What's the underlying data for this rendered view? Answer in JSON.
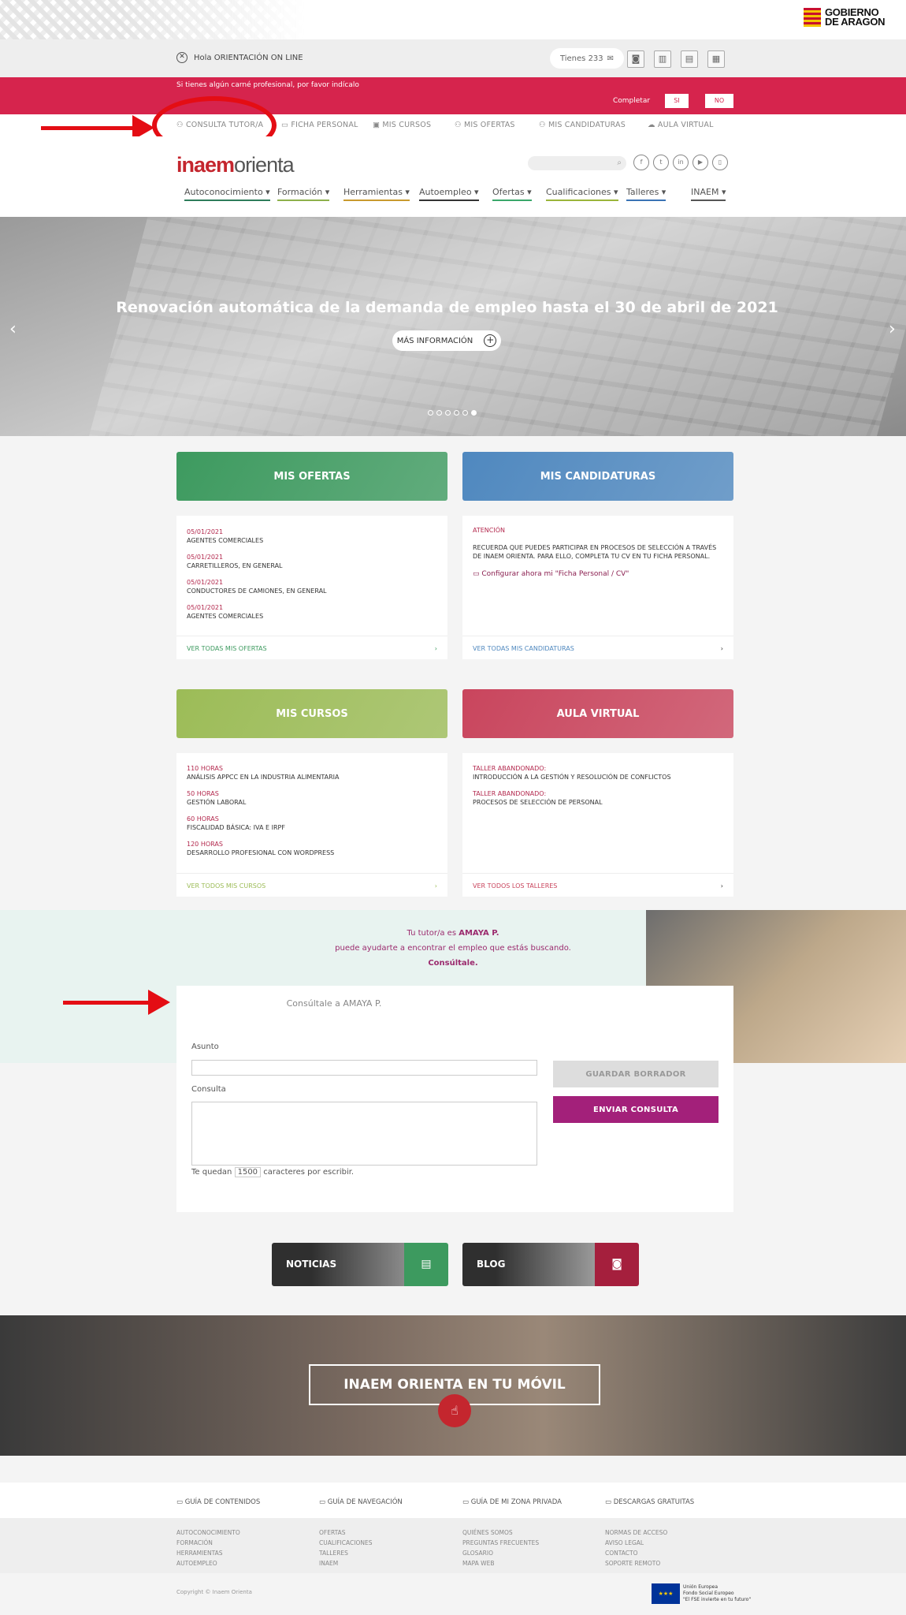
{
  "brand": {
    "gobierno": "GOBIERNO\nDE ARAGON",
    "logo_a": "inaem",
    "logo_b": "orienta"
  },
  "userbar": {
    "greeting": "Hola ORIENTACIÓN ON LINE",
    "tienes": "Tienes 233"
  },
  "alert": {
    "message": "Si tienes algún carné profesional, por favor indícalo",
    "completar": "Completar",
    "si": "SI",
    "no": "NO"
  },
  "secnav": [
    "CONSULTA TUTOR/A",
    "FICHA PERSONAL",
    "MIS CURSOS",
    "MIS OFERTAS",
    "MIS CANDIDATURAS",
    "AULA VIRTUAL"
  ],
  "mainnav": [
    {
      "label": "Autoconocimiento",
      "color": "#2e7d5b"
    },
    {
      "label": "Formación",
      "color": "#8db04b"
    },
    {
      "label": "Herramientas",
      "color": "#c99a2e"
    },
    {
      "label": "Autoempleo",
      "color": "#333333"
    },
    {
      "label": "Ofertas",
      "color": "#3aa86b"
    },
    {
      "label": "Cualificaciones",
      "color": "#9bb53a"
    },
    {
      "label": "Talleres",
      "color": "#3a73b5"
    },
    {
      "label": "INAEM",
      "color": "#555555"
    }
  ],
  "hero": {
    "title": "Renovación automática de la demanda de empleo hasta el 30 de abril de 2021",
    "button": "MÁS INFORMACIÓN",
    "slides": 6,
    "active": 5
  },
  "cards": {
    "ofertas": {
      "title": "MIS OFERTAS",
      "items": [
        {
          "date": "05/01/2021",
          "text": "AGENTES COMERCIALES"
        },
        {
          "date": "05/01/2021",
          "text": "CARRETILLEROS, EN GENERAL"
        },
        {
          "date": "05/01/2021",
          "text": "CONDUCTORES DE CAMIONES, EN GENERAL"
        },
        {
          "date": "05/01/2021",
          "text": "AGENTES COMERCIALES"
        }
      ],
      "footer": "VER TODAS MIS OFERTAS",
      "color": "#3d9a5f"
    },
    "candidaturas": {
      "title": "MIS CANDIDATURAS",
      "atencion": "ATENCIÓN",
      "text": "RECUERDA QUE PUEDES PARTICIPAR EN PROCESOS DE SELECCIÓN A TRAVÉS DE INAEM ORIENTA. PARA ELLO, COMPLETA TU CV EN TU FICHA PERSONAL.",
      "link": "Configurar ahora mi \"Ficha Personal / CV\"",
      "footer": "VER TODAS MIS CANDIDATURAS",
      "color": "#4f88bf"
    },
    "cursos": {
      "title": "MIS CURSOS",
      "items": [
        {
          "date": "110 HORAS",
          "text": "ANÁLISIS APPCC EN LA INDUSTRIA ALIMENTARIA"
        },
        {
          "date": "50 HORAS",
          "text": "GESTIÓN LABORAL"
        },
        {
          "date": "60 HORAS",
          "text": "FISCALIDAD BÁSICA: IVA E IRPF"
        },
        {
          "date": "120 HORAS",
          "text": "DESARROLLO PROFESIONAL CON WORDPRESS"
        }
      ],
      "footer": "VER TODOS MIS CURSOS",
      "color": "#9cbc57"
    },
    "aula": {
      "title": "AULA VIRTUAL",
      "items": [
        {
          "date": "TALLER ABANDONADO:",
          "text": "INTRODUCCIÓN A LA GESTIÓN Y RESOLUCIÓN DE CONFLICTOS"
        },
        {
          "date": "TALLER ABANDONADO:",
          "text": "PROCESOS DE SELECCIÓN DE PERSONAL"
        }
      ],
      "footer": "VER TODOS LOS TALLERES",
      "color": "#c9455d"
    }
  },
  "tutor": {
    "line1_a": "Tu tutor/a es ",
    "line1_b": "AMAYA P.",
    "line2": "puede ayudarte a encontrar el empleo que estás buscando.",
    "line3": "Consúltale."
  },
  "form": {
    "title": "Consúltale a AMAYA P.",
    "asunto": "Asunto",
    "consulta": "Consulta",
    "quedan_a": "Te quedan",
    "count": "1500",
    "quedan_b": "caracteres por escribir.",
    "guardar": "GUARDAR BORRADOR",
    "enviar": "ENVIAR CONSULTA"
  },
  "promo": {
    "noticias": "NOTICIAS",
    "blog": "BLOG",
    "mobile": "INAEM ORIENTA EN TU MÓVIL"
  },
  "guides": [
    "GUÍA DE CONTENIDOS",
    "GUÍA DE NAVEGACIÓN",
    "GUÍA DE MI ZONA PRIVADA",
    "DESCARGAS GRATUITAS"
  ],
  "links": [
    [
      "AUTOCONOCIMIENTO",
      "FORMACIÓN",
      "HERRAMIENTAS",
      "AUTOEMPLEO"
    ],
    [
      "OFERTAS",
      "CUALIFICACIONES",
      "TALLERES",
      "INAEM"
    ],
    [
      "QUIÉNES SOMOS",
      "PREGUNTAS FRECUENTES",
      "GLOSARIO",
      "MAPA WEB"
    ],
    [
      "NORMAS DE ACCESO",
      "AVISO LEGAL",
      "CONTACTO",
      "SOPORTE REMOTO"
    ]
  ],
  "copyright": "Copyright © Inaem Orienta",
  "eu": {
    "l1": "Unión Europea",
    "l2": "Fondo Social Europeo",
    "l3": "\"El FSE invierte en tu futuro\""
  }
}
